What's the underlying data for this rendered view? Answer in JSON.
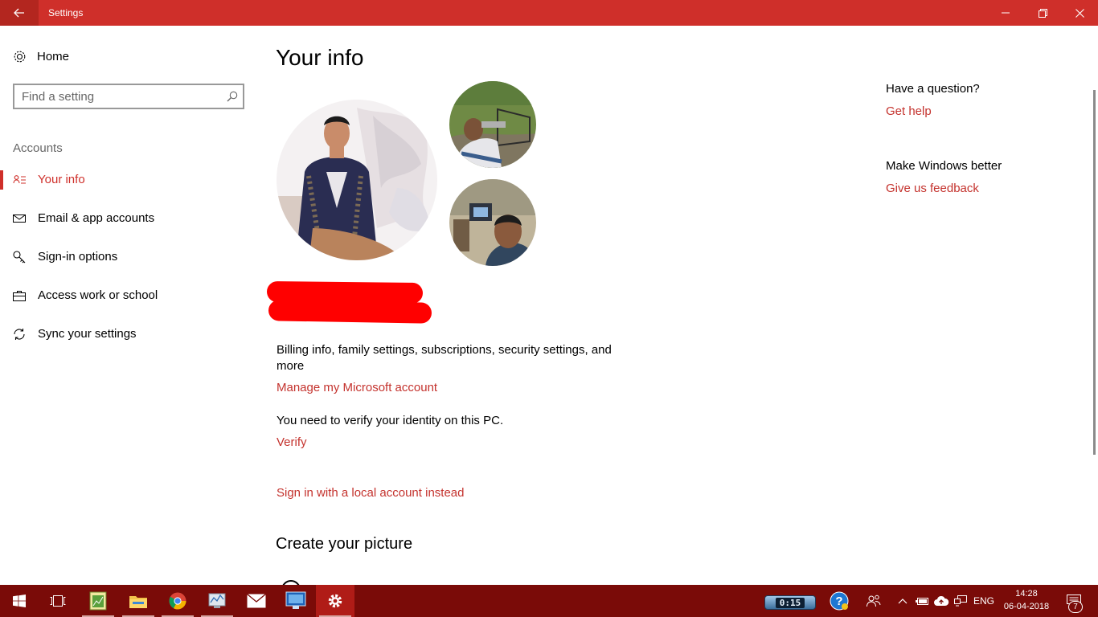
{
  "window": {
    "title": "Settings"
  },
  "sidebar": {
    "home_label": "Home",
    "search_placeholder": "Find a setting",
    "section_label": "Accounts",
    "items": [
      {
        "label": "Your info",
        "icon": "contact-card-icon",
        "active": true
      },
      {
        "label": "Email & app accounts",
        "icon": "mail-icon",
        "active": false
      },
      {
        "label": "Sign-in options",
        "icon": "key-icon",
        "active": false
      },
      {
        "label": "Access work or school",
        "icon": "briefcase-icon",
        "active": false
      },
      {
        "label": "Sync your settings",
        "icon": "sync-icon",
        "active": false
      }
    ]
  },
  "main": {
    "title": "Your info",
    "billing_text": "Billing info, family settings, subscriptions, security settings, and more",
    "manage_link": "Manage my Microsoft account",
    "verify_text": "You need to verify your identity on this PC.",
    "verify_link": "Verify",
    "local_account_link": "Sign in with a local account instead",
    "create_picture_heading": "Create your picture"
  },
  "right_pane": {
    "question_heading": "Have a question?",
    "help_link": "Get help",
    "improve_heading": "Make Windows better",
    "feedback_link": "Give us feedback"
  },
  "taskbar": {
    "timer": "0:15",
    "language": "ENG",
    "time": "14:28",
    "date": "06-04-2018",
    "notification_count": "7"
  },
  "colors": {
    "accent": "#cf2f2a",
    "link": "#c4322d",
    "taskbar": "#7a0b08",
    "redaction": "#ff0000"
  }
}
